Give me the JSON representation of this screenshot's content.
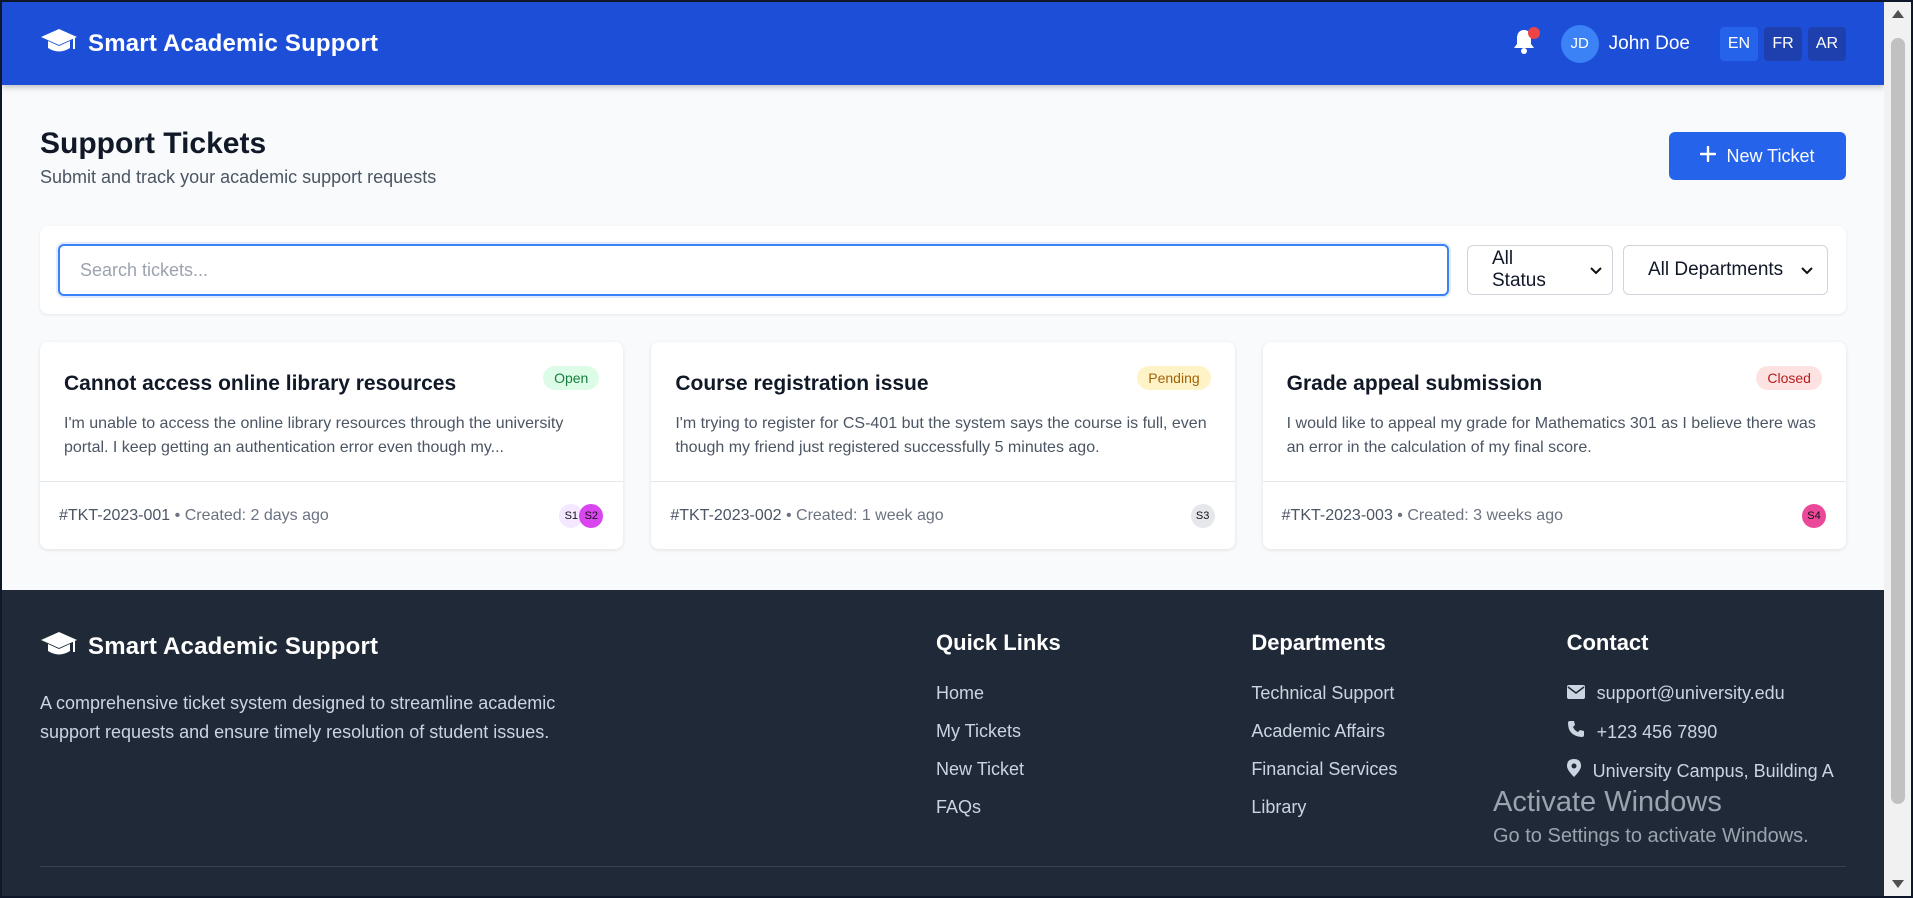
{
  "header": {
    "brand": "Smart Academic Support",
    "user_initials": "JD",
    "user_name": "John Doe",
    "languages": [
      "EN",
      "FR",
      "AR"
    ],
    "active_language": "EN",
    "notifications_unread": true
  },
  "page": {
    "title": "Support Tickets",
    "subtitle": "Submit and track your academic support requests",
    "new_ticket_label": "New Ticket"
  },
  "filters": {
    "search_placeholder": "Search tickets...",
    "status_value": "All Status",
    "department_value": "All Departments"
  },
  "tickets": [
    {
      "title": "Cannot access online library resources",
      "status": "Open",
      "description": "I'm unable to access the online library resources through the university portal. I keep getting an authentication error even though my...",
      "id": "#TKT-2023-001",
      "created": "• Created: 2 days ago",
      "assignees": [
        {
          "label": "S1",
          "color": "#f3e8ff"
        },
        {
          "label": "S2",
          "color": "#d946ef"
        }
      ]
    },
    {
      "title": "Course registration issue",
      "status": "Pending",
      "description": "I'm trying to register for CS-401 but the system says the course is full, even though my friend just registered successfully 5 minutes ago.",
      "id": "#TKT-2023-002",
      "created": "• Created: 1 week ago",
      "assignees": [
        {
          "label": "S3",
          "color": "#e5e7eb"
        }
      ]
    },
    {
      "title": "Grade appeal submission",
      "status": "Closed",
      "description": "I would like to appeal my grade for Mathematics 301 as I believe there was an error in the calculation of my final score.",
      "id": "#TKT-2023-003",
      "created": "• Created: 3 weeks ago",
      "assignees": [
        {
          "label": "S4",
          "color": "#ec4899"
        }
      ]
    }
  ],
  "footer": {
    "brand": "Smart Academic Support",
    "description": "A comprehensive ticket system designed to streamline academic support requests and ensure timely resolution of student issues.",
    "quick_links_title": "Quick Links",
    "quick_links": [
      "Home",
      "My Tickets",
      "New Ticket",
      "FAQs"
    ],
    "departments_title": "Departments",
    "departments": [
      "Technical Support",
      "Academic Affairs",
      "Financial Services",
      "Library"
    ],
    "contact_title": "Contact",
    "contact_email": "support@university.edu",
    "contact_phone": "+123 456 7890",
    "contact_address": "University Campus, Building A"
  },
  "watermark": {
    "title": "Activate Windows",
    "subtitle": "Go to Settings to activate Windows."
  },
  "colors": {
    "primary": "#1d4ed8",
    "button": "#2563eb",
    "footer_bg": "#1f2937"
  }
}
